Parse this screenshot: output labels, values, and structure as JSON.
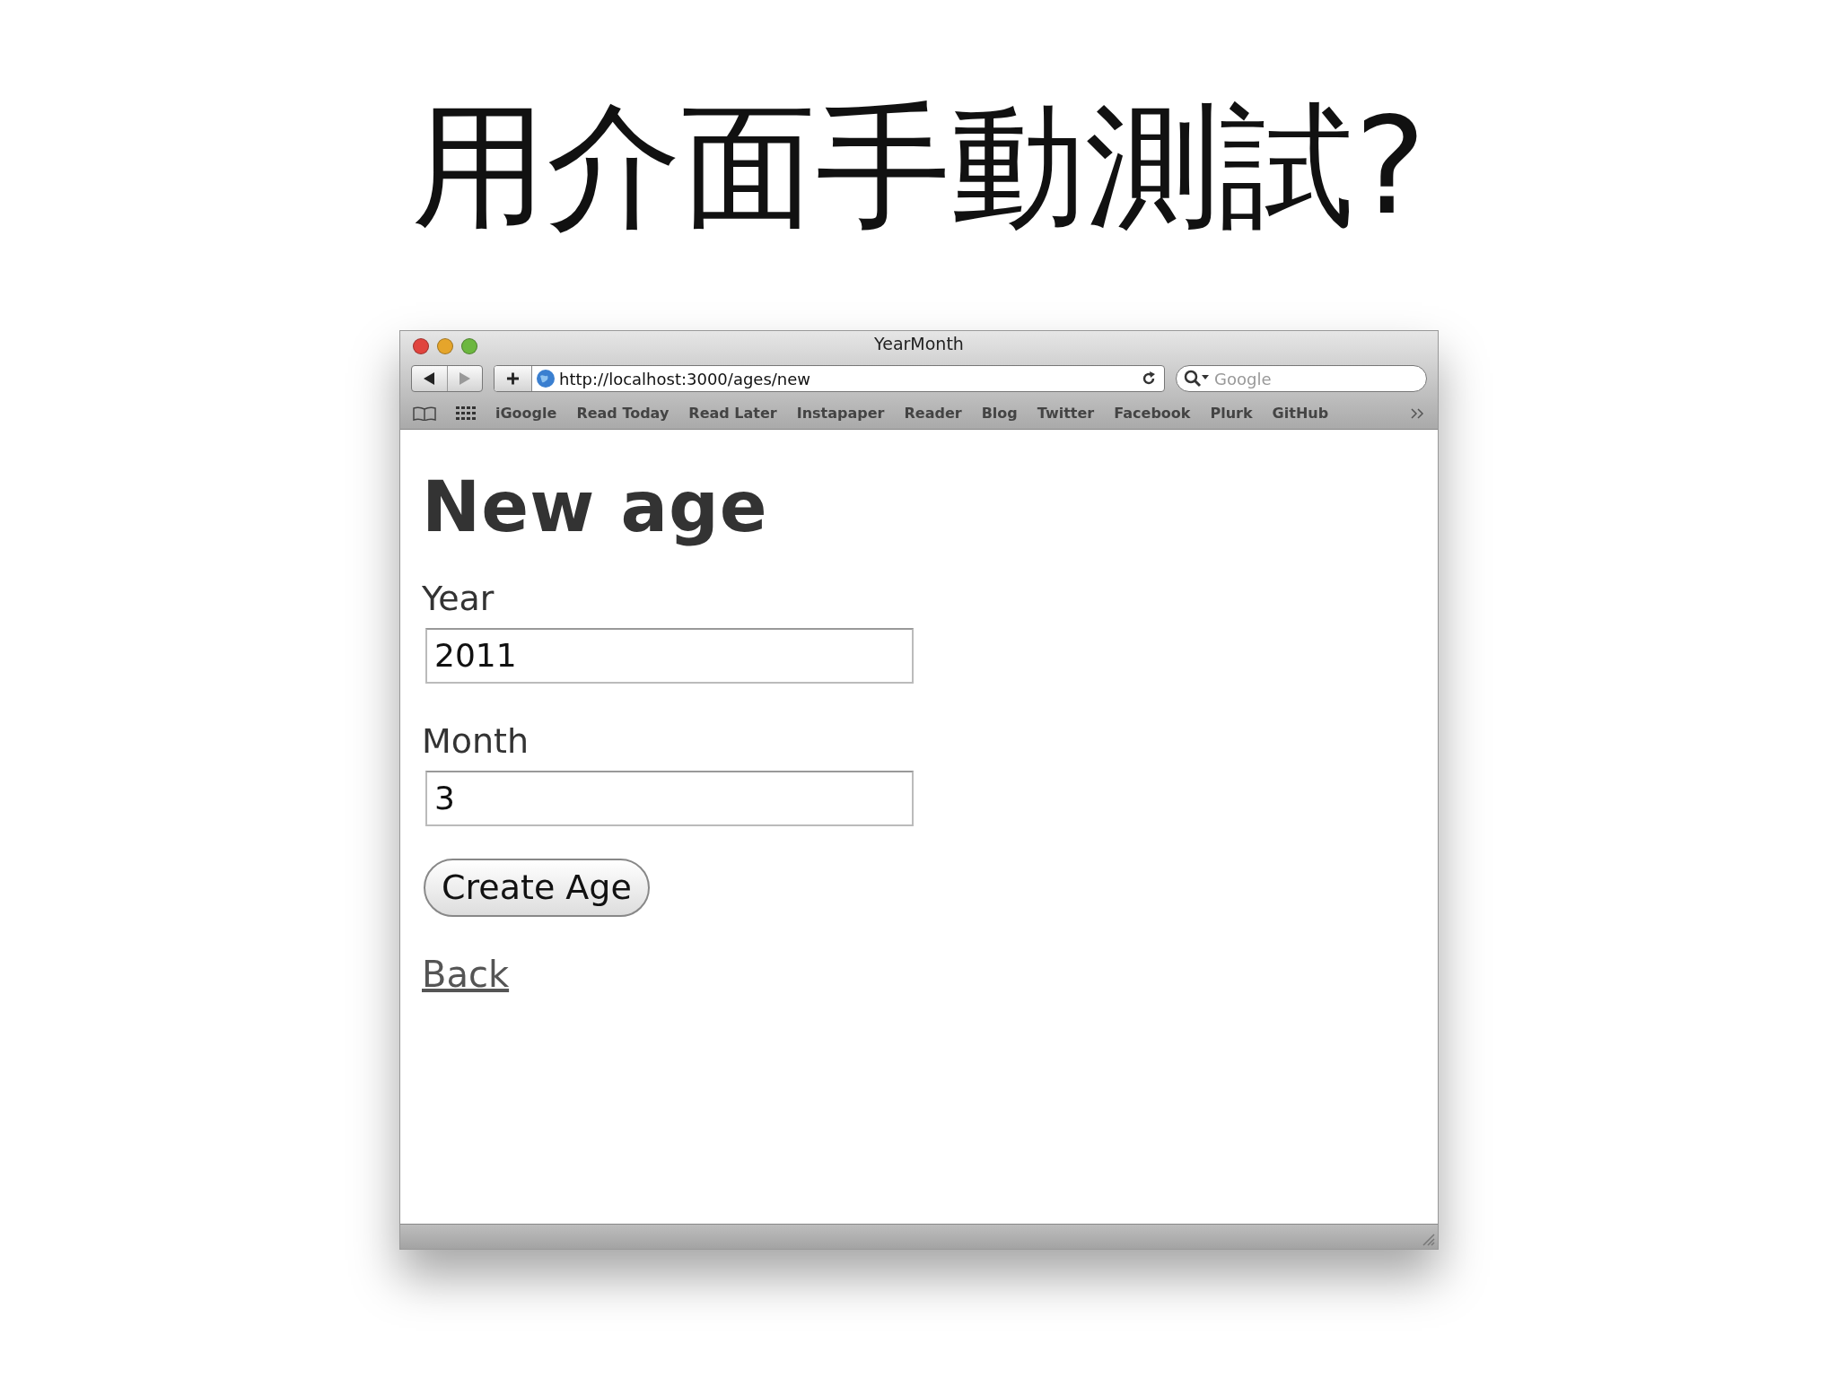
{
  "slide": {
    "title": "用介面手動測試?"
  },
  "window": {
    "title": "YearMonth"
  },
  "toolbar": {
    "url": "http://localhost:3000/ages/new",
    "search": {
      "placeholder": "Google"
    }
  },
  "bookmarks": [
    "iGoogle",
    "Read Today",
    "Read Later",
    "Instapaper",
    "Reader",
    "Blog",
    "Twitter",
    "Facebook",
    "Plurk",
    "GitHub"
  ],
  "page": {
    "heading": "New age",
    "fields": [
      {
        "label": "Year",
        "value": "2011"
      },
      {
        "label": "Month",
        "value": "3"
      }
    ],
    "submit": "Create Age",
    "link": "Back"
  }
}
